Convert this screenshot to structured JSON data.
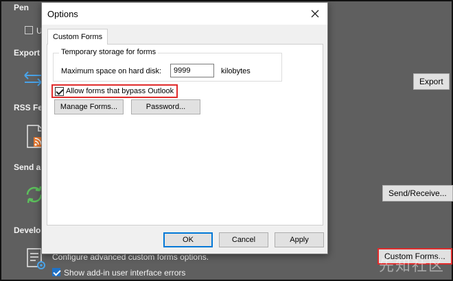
{
  "background": {
    "sections": {
      "pen": "Pen",
      "pen_checkbox_label": "Us",
      "export": "Export",
      "rss": "RSS Fee",
      "send": "Send an",
      "developer": "Develop"
    },
    "export_button": "Export",
    "send_receive_button": "Send/Receive...",
    "custom_forms_button": "Custom Forms...",
    "custom_forms_desc": "Configure advanced custom forms options.",
    "show_addin_errors": "Show add-in user interface errors",
    "watermark": "先知社区"
  },
  "dialog": {
    "title": "Options",
    "tab": "Custom Forms",
    "group_title": "Temporary storage for forms",
    "max_space_label": "Maximum space on hard disk:",
    "max_space_value": "9999",
    "unit": "kilobytes",
    "allow_bypass_label": "Allow forms that bypass Outlook",
    "manage_forms": "Manage Forms...",
    "password": "Password...",
    "ok": "OK",
    "cancel": "Cancel",
    "apply": "Apply"
  },
  "colors": {
    "dim_background": "#5f5f5f",
    "highlight": "#e02b2b",
    "accent": "#1e72c8"
  }
}
